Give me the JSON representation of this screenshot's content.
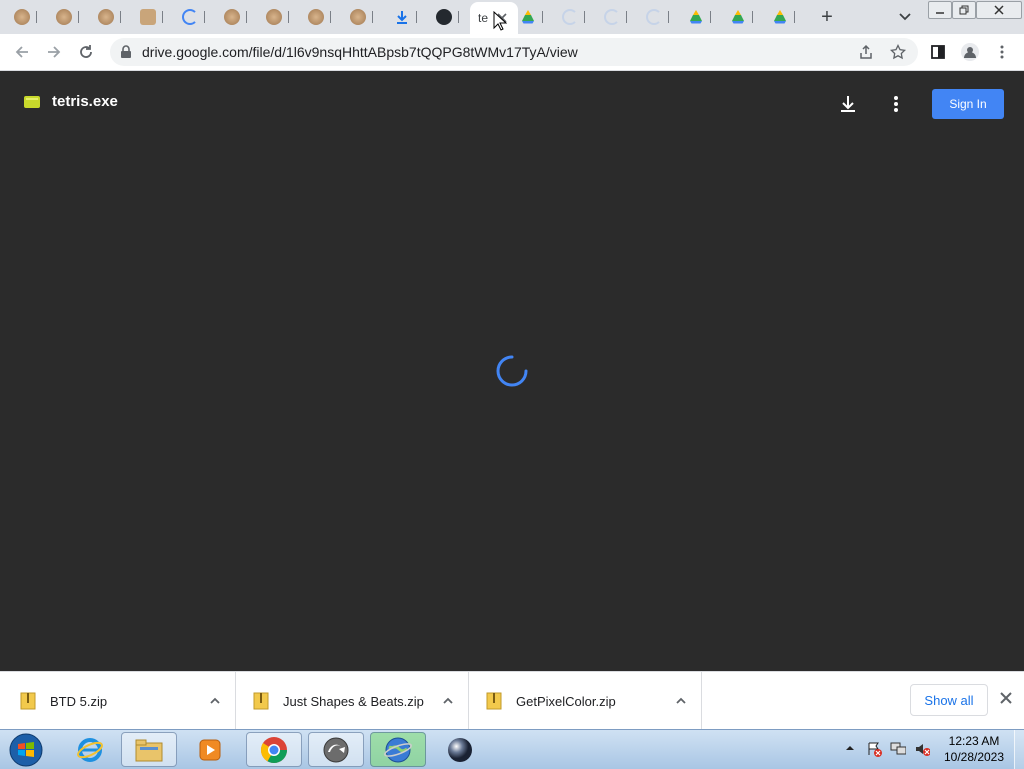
{
  "browser": {
    "active_tab_title": "te",
    "url": "drive.google.com/file/d/1l6v9nsqHhttABpsb7tQQPG8tWMv17TyA/view",
    "new_tab_label": "+",
    "window_controls": [
      "minimize",
      "restore",
      "close"
    ]
  },
  "viewer": {
    "file_name": "tetris.exe",
    "sign_in_label": "Sign In",
    "accent": "#4285f4"
  },
  "downloads": {
    "items": [
      {
        "name": "BTD 5.zip"
      },
      {
        "name": "Just Shapes & Beats.zip"
      },
      {
        "name": "GetPixelColor.zip"
      }
    ],
    "show_all_label": "Show all"
  },
  "taskbar": {
    "time": "12:23 AM",
    "date": "10/28/2023"
  }
}
